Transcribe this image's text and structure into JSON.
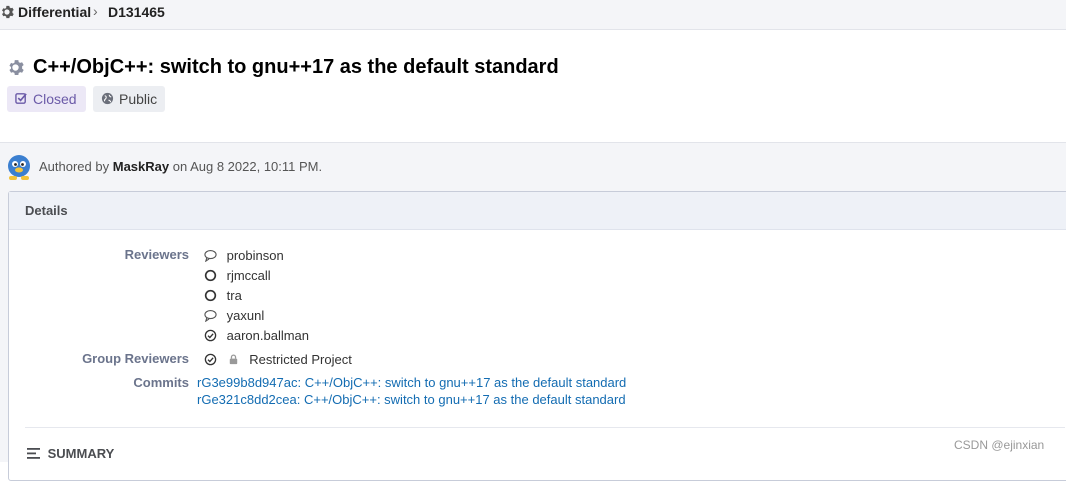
{
  "breadcrumb": {
    "app": "Differential",
    "separator": "›",
    "revision": "D131465"
  },
  "header": {
    "title": "C++/ObjC++: switch to gnu++17 as the default standard",
    "tags": [
      {
        "label": "Closed",
        "icon": "check-square-icon"
      },
      {
        "label": "Public",
        "icon": "globe-icon"
      }
    ]
  },
  "author": {
    "prefix": "Authored by",
    "name": "MaskRay",
    "date": "on Aug 8 2022, 10:11 PM."
  },
  "details": {
    "title": "Details",
    "reviewers_label": "Reviewers",
    "reviewers": [
      {
        "name": "probinson",
        "status_icon": "comment-icon"
      },
      {
        "name": "rjmccall",
        "status_icon": "circle-icon"
      },
      {
        "name": "tra",
        "status_icon": "circle-icon"
      },
      {
        "name": "yaxunl",
        "status_icon": "comment-icon"
      },
      {
        "name": "aaron.ballman",
        "status_icon": "check-circle-icon"
      }
    ],
    "group_reviewers_label": "Group Reviewers",
    "group_reviewers": [
      {
        "name": "Restricted Project",
        "status_icon": "check-circle-icon",
        "lock_icon": "lock-icon"
      }
    ],
    "commits_label": "Commits",
    "commits": [
      "rG3e99b8d947ac: C++/ObjC++: switch to gnu++17 as the default standard",
      "rGe321c8dd2cea: C++/ObjC++: switch to gnu++17 as the default standard"
    ]
  },
  "summary_label": "SUMMARY",
  "watermark": "CSDN @ejinxian",
  "colors": {
    "link": "#136cb2",
    "closed_tag_bg": "#ece8f6",
    "page_bg": "#f4f5f8"
  }
}
